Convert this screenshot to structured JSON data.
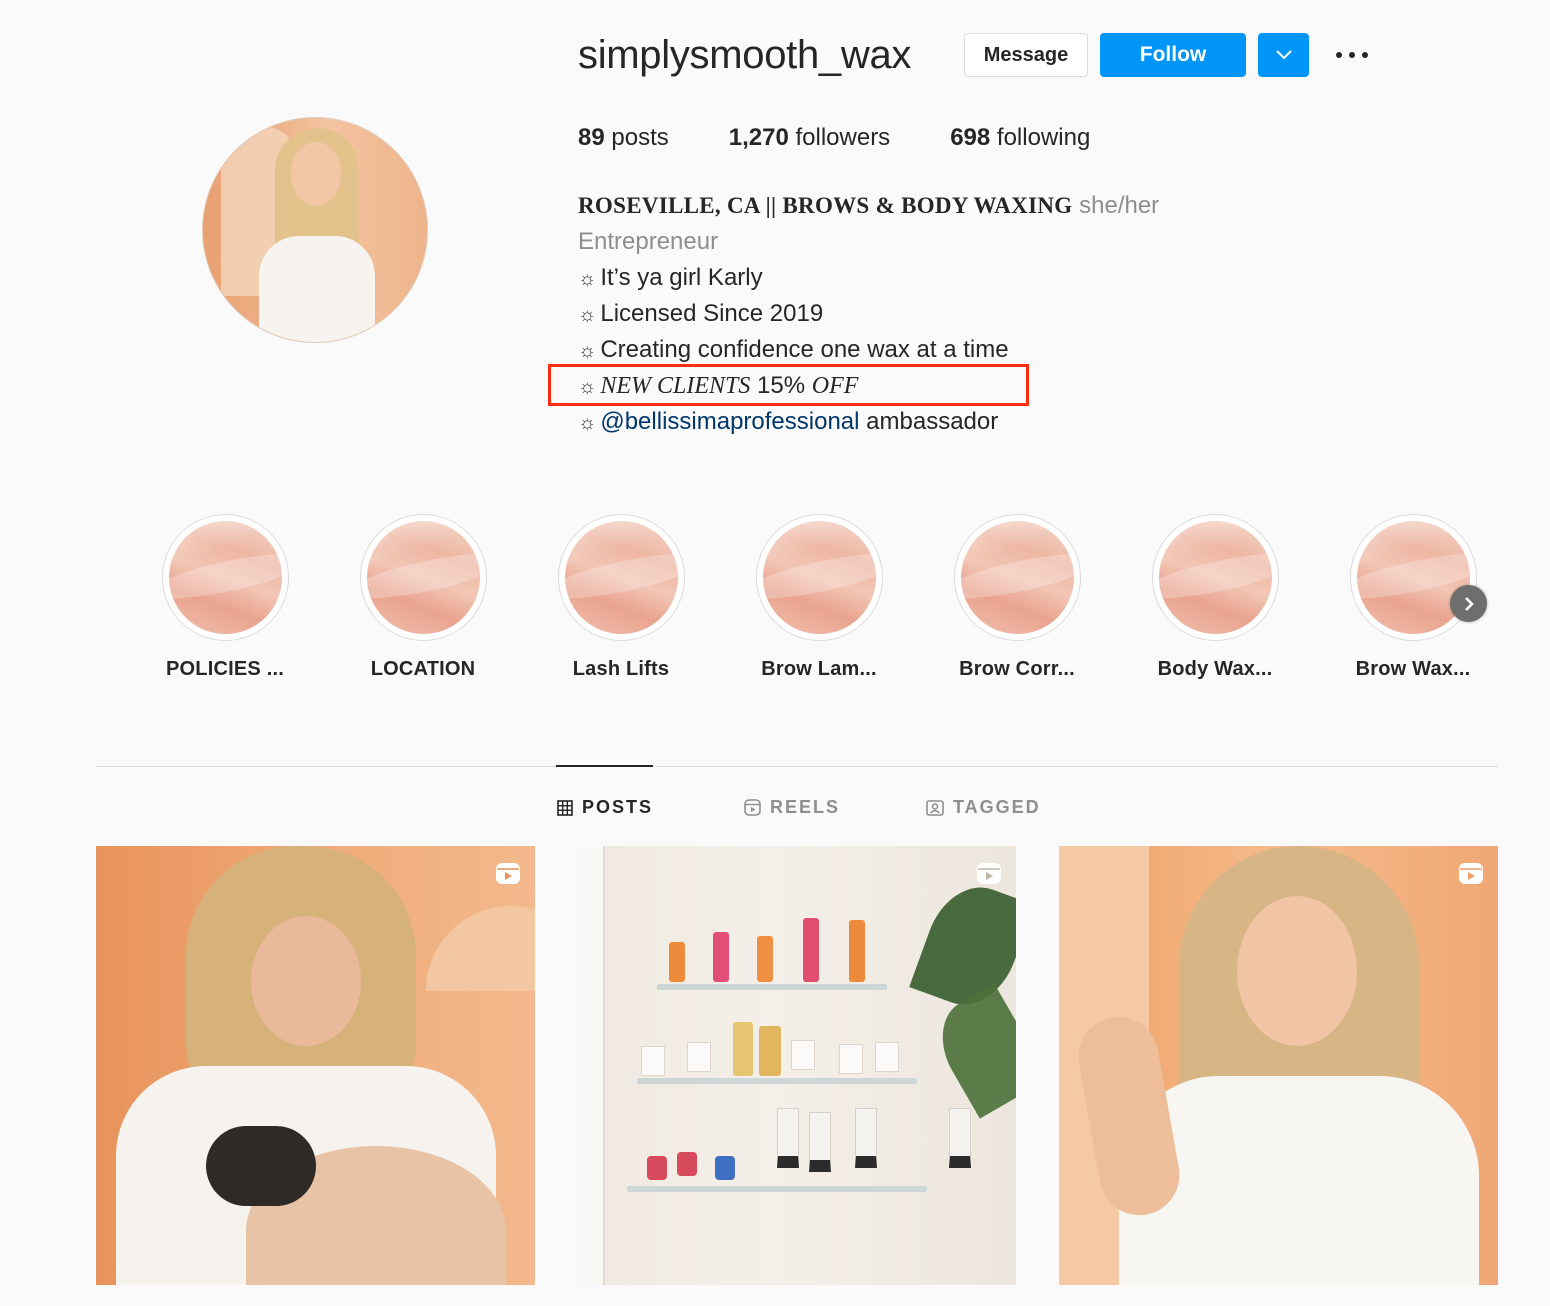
{
  "profile": {
    "username": "simplysmooth_wax",
    "message_label": "Message",
    "follow_label": "Follow",
    "stats": {
      "posts_count": "89",
      "posts_label": "posts",
      "followers_count": "1,270",
      "followers_label": "followers",
      "following_count": "698",
      "following_label": "following"
    },
    "bio": {
      "name": "ROSEVILLE, CA || BROWS & BODY WAXING",
      "pronouns": "she/her",
      "category": "Entrepreneur",
      "star": "☼",
      "line1": "It’s ya girl Karly",
      "line2": "Licensed Since 2019",
      "line3": "Creating confidence one wax at a time",
      "line4_italic_a": "NEW CLIENTS",
      "line4_plain": "15%",
      "line4_italic_b": "OFF",
      "line5_mention": "@bellissimaprofessional",
      "line5_text": "ambassador"
    }
  },
  "highlights": [
    {
      "label": "POLICIES ..."
    },
    {
      "label": "LOCATION"
    },
    {
      "label": "Lash Lifts"
    },
    {
      "label": "Brow Lam..."
    },
    {
      "label": "Brow Corr..."
    },
    {
      "label": "Body Wax..."
    },
    {
      "label": "Brow Wax..."
    }
  ],
  "tabs": [
    {
      "label": "POSTS",
      "icon": "grid-icon",
      "active": true
    },
    {
      "label": "REELS",
      "icon": "reels-icon",
      "active": false
    },
    {
      "label": "TAGGED",
      "icon": "tagged-icon",
      "active": false
    }
  ],
  "posts": [
    {
      "type": "reel",
      "icon": "reel-icon"
    },
    {
      "type": "reel",
      "icon": "reel-icon"
    },
    {
      "type": "reel",
      "icon": "reel-icon"
    }
  ],
  "colors": {
    "accent": "#0095f6",
    "highlight_box": "#ff2d0f",
    "link": "#00376b",
    "muted": "#8e8e8e"
  }
}
